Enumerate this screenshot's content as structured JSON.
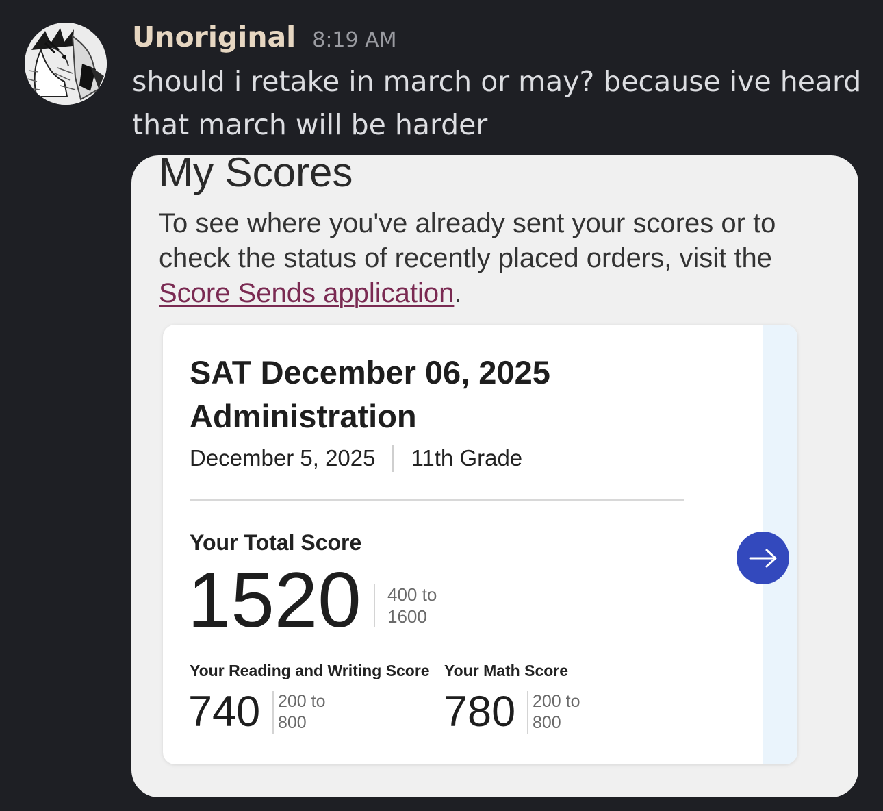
{
  "message": {
    "username": "Unoriginal",
    "timestamp": "8:19 AM",
    "text_line1": "should i retake in march or may? because ive heard",
    "text_line2": "that march will be harder",
    "avatar_icon": "manga-avatar-icon"
  },
  "scores_page": {
    "title": "My Scores",
    "intro_text": "To see where you've already sent your scores or to check the status of recently placed orders, visit the",
    "link_text": "Score Sends application",
    "intro_end": ".",
    "colors": {
      "link": "#7a2a52",
      "arrow_button": "#3349bd",
      "card_strip": "#eaf4fc"
    },
    "card": {
      "title": "SAT December 06, 2025 Administration",
      "date": "December 5, 2025",
      "grade": "11th Grade",
      "total_label": "Your Total Score",
      "total_score": "1520",
      "total_range_line1": "400 to",
      "total_range_line2": "1600",
      "rw_label": "Your Reading and Writing Score",
      "rw_score": "740",
      "rw_range_line1": "200 to",
      "rw_range_line2": "800",
      "math_label": "Your Math Score",
      "math_score": "780",
      "math_range_line1": "200 to",
      "math_range_line2": "800",
      "arrow_icon": "arrow-right-icon"
    }
  }
}
